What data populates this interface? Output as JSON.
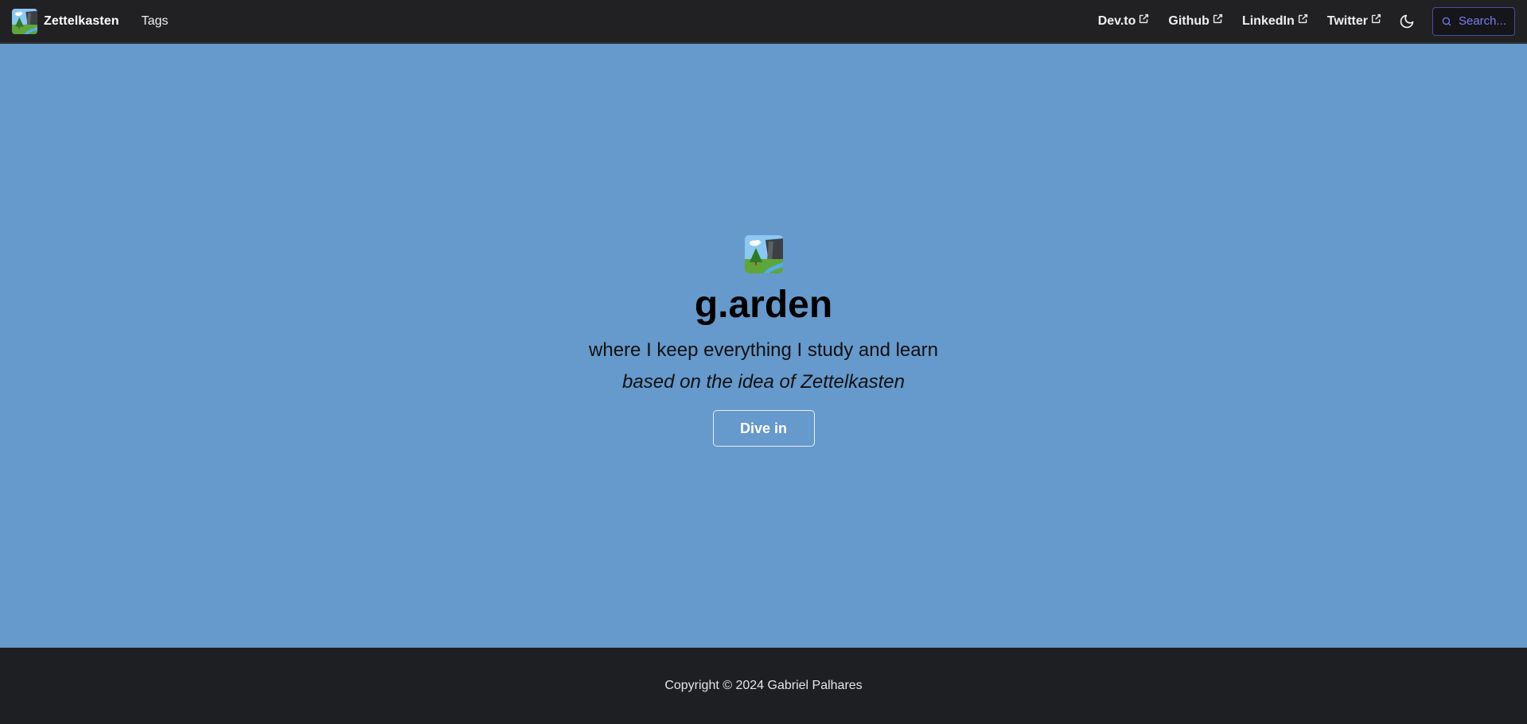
{
  "navbar": {
    "brand": "Zettelkasten",
    "tags_label": "Tags",
    "external_links": [
      {
        "label": "Dev.to"
      },
      {
        "label": "Github"
      },
      {
        "label": "LinkedIn"
      },
      {
        "label": "Twitter"
      }
    ],
    "search_placeholder": "Search...",
    "theme_icon": "moon-icon"
  },
  "hero": {
    "title": "g.arden",
    "subtitle": "where I keep everything I study and learn",
    "tagline": "based on the idea of Zettelkasten",
    "button_label": "Dive in",
    "background": "#6699cc"
  },
  "footer": {
    "copyright": "Copyright © 2024 Gabriel Palhares"
  },
  "colors": {
    "navbar_bg": "#212124",
    "hero_bg": "#6699cc",
    "footer_bg": "#1e1f22",
    "search_accent": "#7b7cf5"
  }
}
